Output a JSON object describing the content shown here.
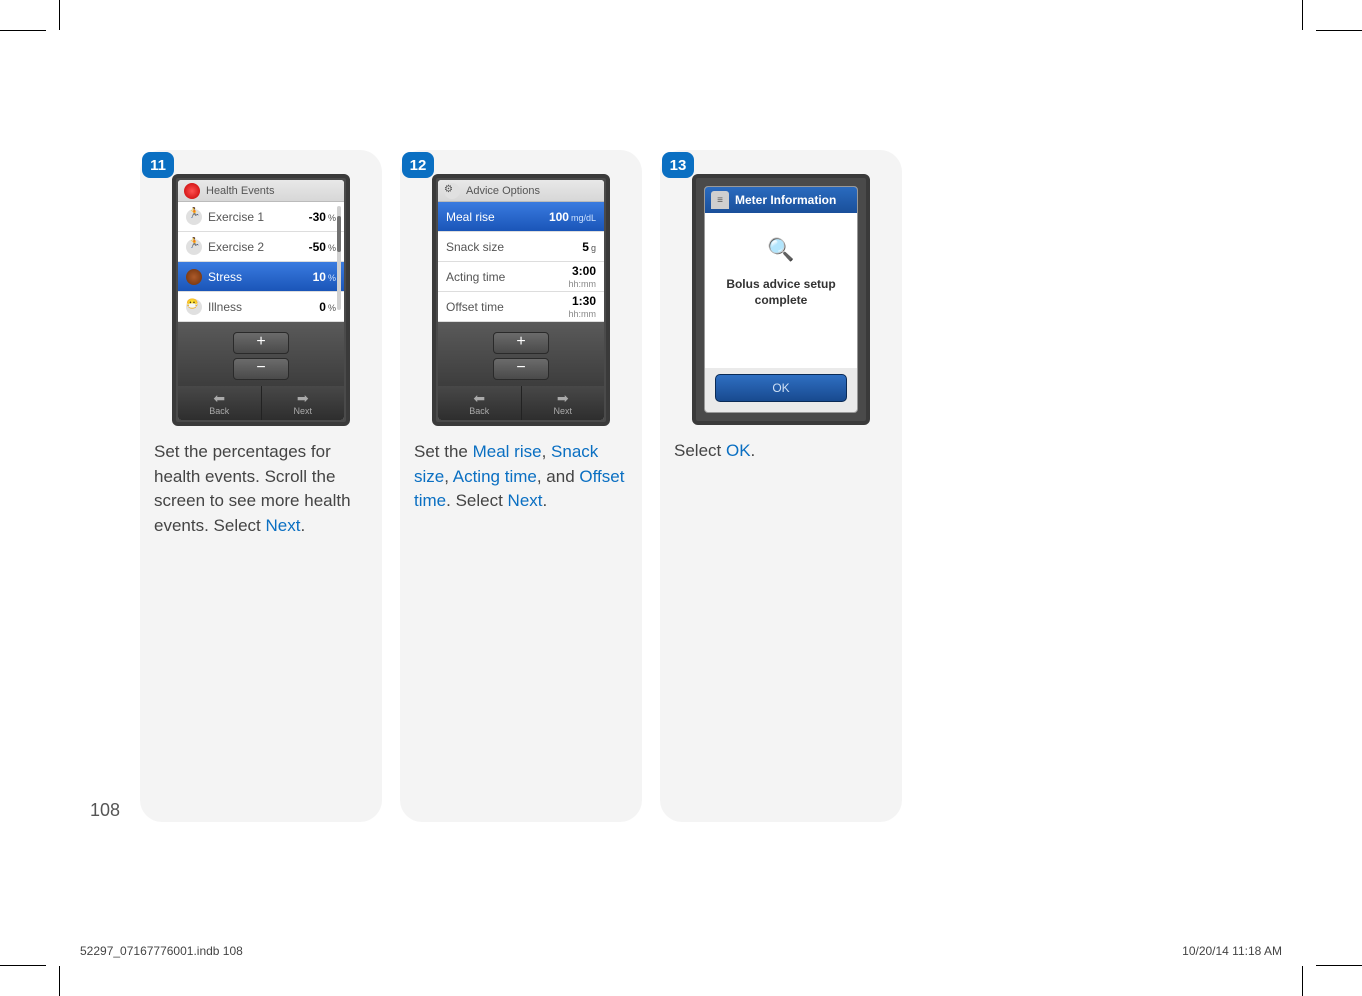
{
  "page_number": "108",
  "footer": {
    "file": "52297_07167776001.indb   108",
    "datetime": "10/20/14   11:18 AM"
  },
  "steps": [
    {
      "num": "11",
      "screen_title": "Health Events",
      "rows": [
        {
          "icon": "run",
          "label": "Exercise 1",
          "value": "-30",
          "unit": "%",
          "selected": false
        },
        {
          "icon": "run",
          "label": "Exercise 2",
          "value": "-50",
          "unit": "%",
          "selected": false
        },
        {
          "icon": "stress",
          "label": "Stress",
          "value": "10",
          "unit": "%",
          "selected": true
        },
        {
          "icon": "ill",
          "label": "Illness",
          "value": "0",
          "unit": "%",
          "selected": false
        }
      ],
      "nav": {
        "back": "Back",
        "next": "Next"
      },
      "caption_parts": [
        {
          "t": "Set the percentages for health events. Scroll the screen to see more health events. Select ",
          "hl": false
        },
        {
          "t": "Next",
          "hl": true
        },
        {
          "t": ".",
          "hl": false
        }
      ]
    },
    {
      "num": "12",
      "screen_title": "Advice Options",
      "rows": [
        {
          "label": "Meal rise",
          "value": "100",
          "unit": "mg/dL",
          "selected": true
        },
        {
          "label": "Snack size",
          "value": "5",
          "unit": "g",
          "selected": false
        },
        {
          "label": "Acting time",
          "value": "3:00",
          "unit": "hh:mm",
          "selected": false,
          "stack": true
        },
        {
          "label": "Offset time",
          "value": "1:30",
          "unit": "hh:mm",
          "selected": false,
          "stack": true
        }
      ],
      "nav": {
        "back": "Back",
        "next": "Next"
      },
      "caption_parts": [
        {
          "t": "Set the ",
          "hl": false
        },
        {
          "t": "Meal rise",
          "hl": true
        },
        {
          "t": ", ",
          "hl": false
        },
        {
          "t": "Snack size",
          "hl": true
        },
        {
          "t": ", ",
          "hl": false
        },
        {
          "t": "Acting time",
          "hl": true
        },
        {
          "t": ", and ",
          "hl": false
        },
        {
          "t": "Offset time",
          "hl": true
        },
        {
          "t": ". Select ",
          "hl": false
        },
        {
          "t": "Next",
          "hl": true
        },
        {
          "t": ".",
          "hl": false
        }
      ]
    },
    {
      "num": "13",
      "screen_title": "Meter Information",
      "message": "Bolus advice setup complete",
      "ok_label": "OK",
      "caption_parts": [
        {
          "t": "Select ",
          "hl": false
        },
        {
          "t": "OK",
          "hl": true
        },
        {
          "t": ".",
          "hl": false
        }
      ]
    }
  ]
}
